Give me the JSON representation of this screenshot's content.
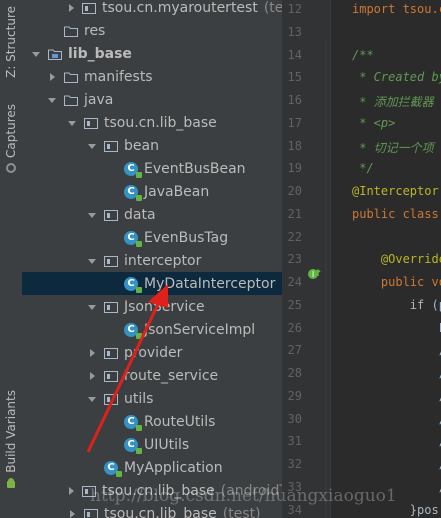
{
  "sidebar": {
    "structure_tab": "Z: Structure",
    "captures_tab": "Captures",
    "build_variants_tab": "Build Variants"
  },
  "tree": {
    "rows": [
      {
        "label": "tsou.cn.myaroutertest",
        "suffix": "(test",
        "kind": "package"
      },
      {
        "label": "res",
        "kind": "folder"
      },
      {
        "label": "lib_base",
        "kind": "module"
      },
      {
        "label": "manifests",
        "kind": "folder"
      },
      {
        "label": "java",
        "kind": "folder"
      },
      {
        "label": "tsou.cn.lib_base",
        "kind": "package"
      },
      {
        "label": "bean",
        "kind": "package"
      },
      {
        "label": "EventBusBean",
        "kind": "class"
      },
      {
        "label": "JavaBean",
        "kind": "class"
      },
      {
        "label": "data",
        "kind": "package"
      },
      {
        "label": "EvenBusTag",
        "kind": "class"
      },
      {
        "label": "interceptor",
        "kind": "package"
      },
      {
        "label": "MyDataInterceptor",
        "kind": "class",
        "selected": true
      },
      {
        "label": "JsonService",
        "kind": "package"
      },
      {
        "label": "JsonServiceImpl",
        "kind": "class"
      },
      {
        "label": "provider",
        "kind": "package"
      },
      {
        "label": "route_service",
        "kind": "package"
      },
      {
        "label": "utils",
        "kind": "package"
      },
      {
        "label": "RouteUtils",
        "kind": "class"
      },
      {
        "label": "UIUtils",
        "kind": "class"
      },
      {
        "label": "MyApplication",
        "kind": "class"
      },
      {
        "label": "tsou.cn.lib_base",
        "suffix": "(androidTest)",
        "kind": "package"
      },
      {
        "label": "tsou.cn.lib_base",
        "suffix": "(test)",
        "kind": "package"
      }
    ]
  },
  "editor": {
    "line_numbers": [
      "12",
      "13",
      "14",
      "15",
      "16",
      "17",
      "18",
      "19",
      "20",
      "21",
      "22",
      "23",
      "24",
      "25",
      "26",
      "27",
      "28",
      "29",
      "30",
      "31",
      "32",
      "33",
      "34"
    ],
    "lines": {
      "l12": "import tsou.c",
      "l14": "/**",
      "l15": " * Created by",
      "l16": " * 添加拦截器",
      "l17": " * <p>",
      "l18": " * 切记一个项",
      "l19": " */",
      "l20": "@Interceptor(",
      "l21": "public class ",
      "l23": "    @Override",
      "l24": "    public vo",
      "l25": "        if (p",
      "l26": "            L",
      "l27": "            /",
      "l28": "            /",
      "l29": "            /",
      "l30": "            /",
      "l31": "            /",
      "l32": "            /",
      "l33": "            /",
      "l34": "        }pos",
      "l35": "            cal"
    }
  },
  "watermark": "http://blog.csdn.net/huangxiaoguo1",
  "colors": {
    "selection": "#0d293e",
    "class_icon": "#3592c4",
    "annotation_arrow": "#e0201a"
  }
}
